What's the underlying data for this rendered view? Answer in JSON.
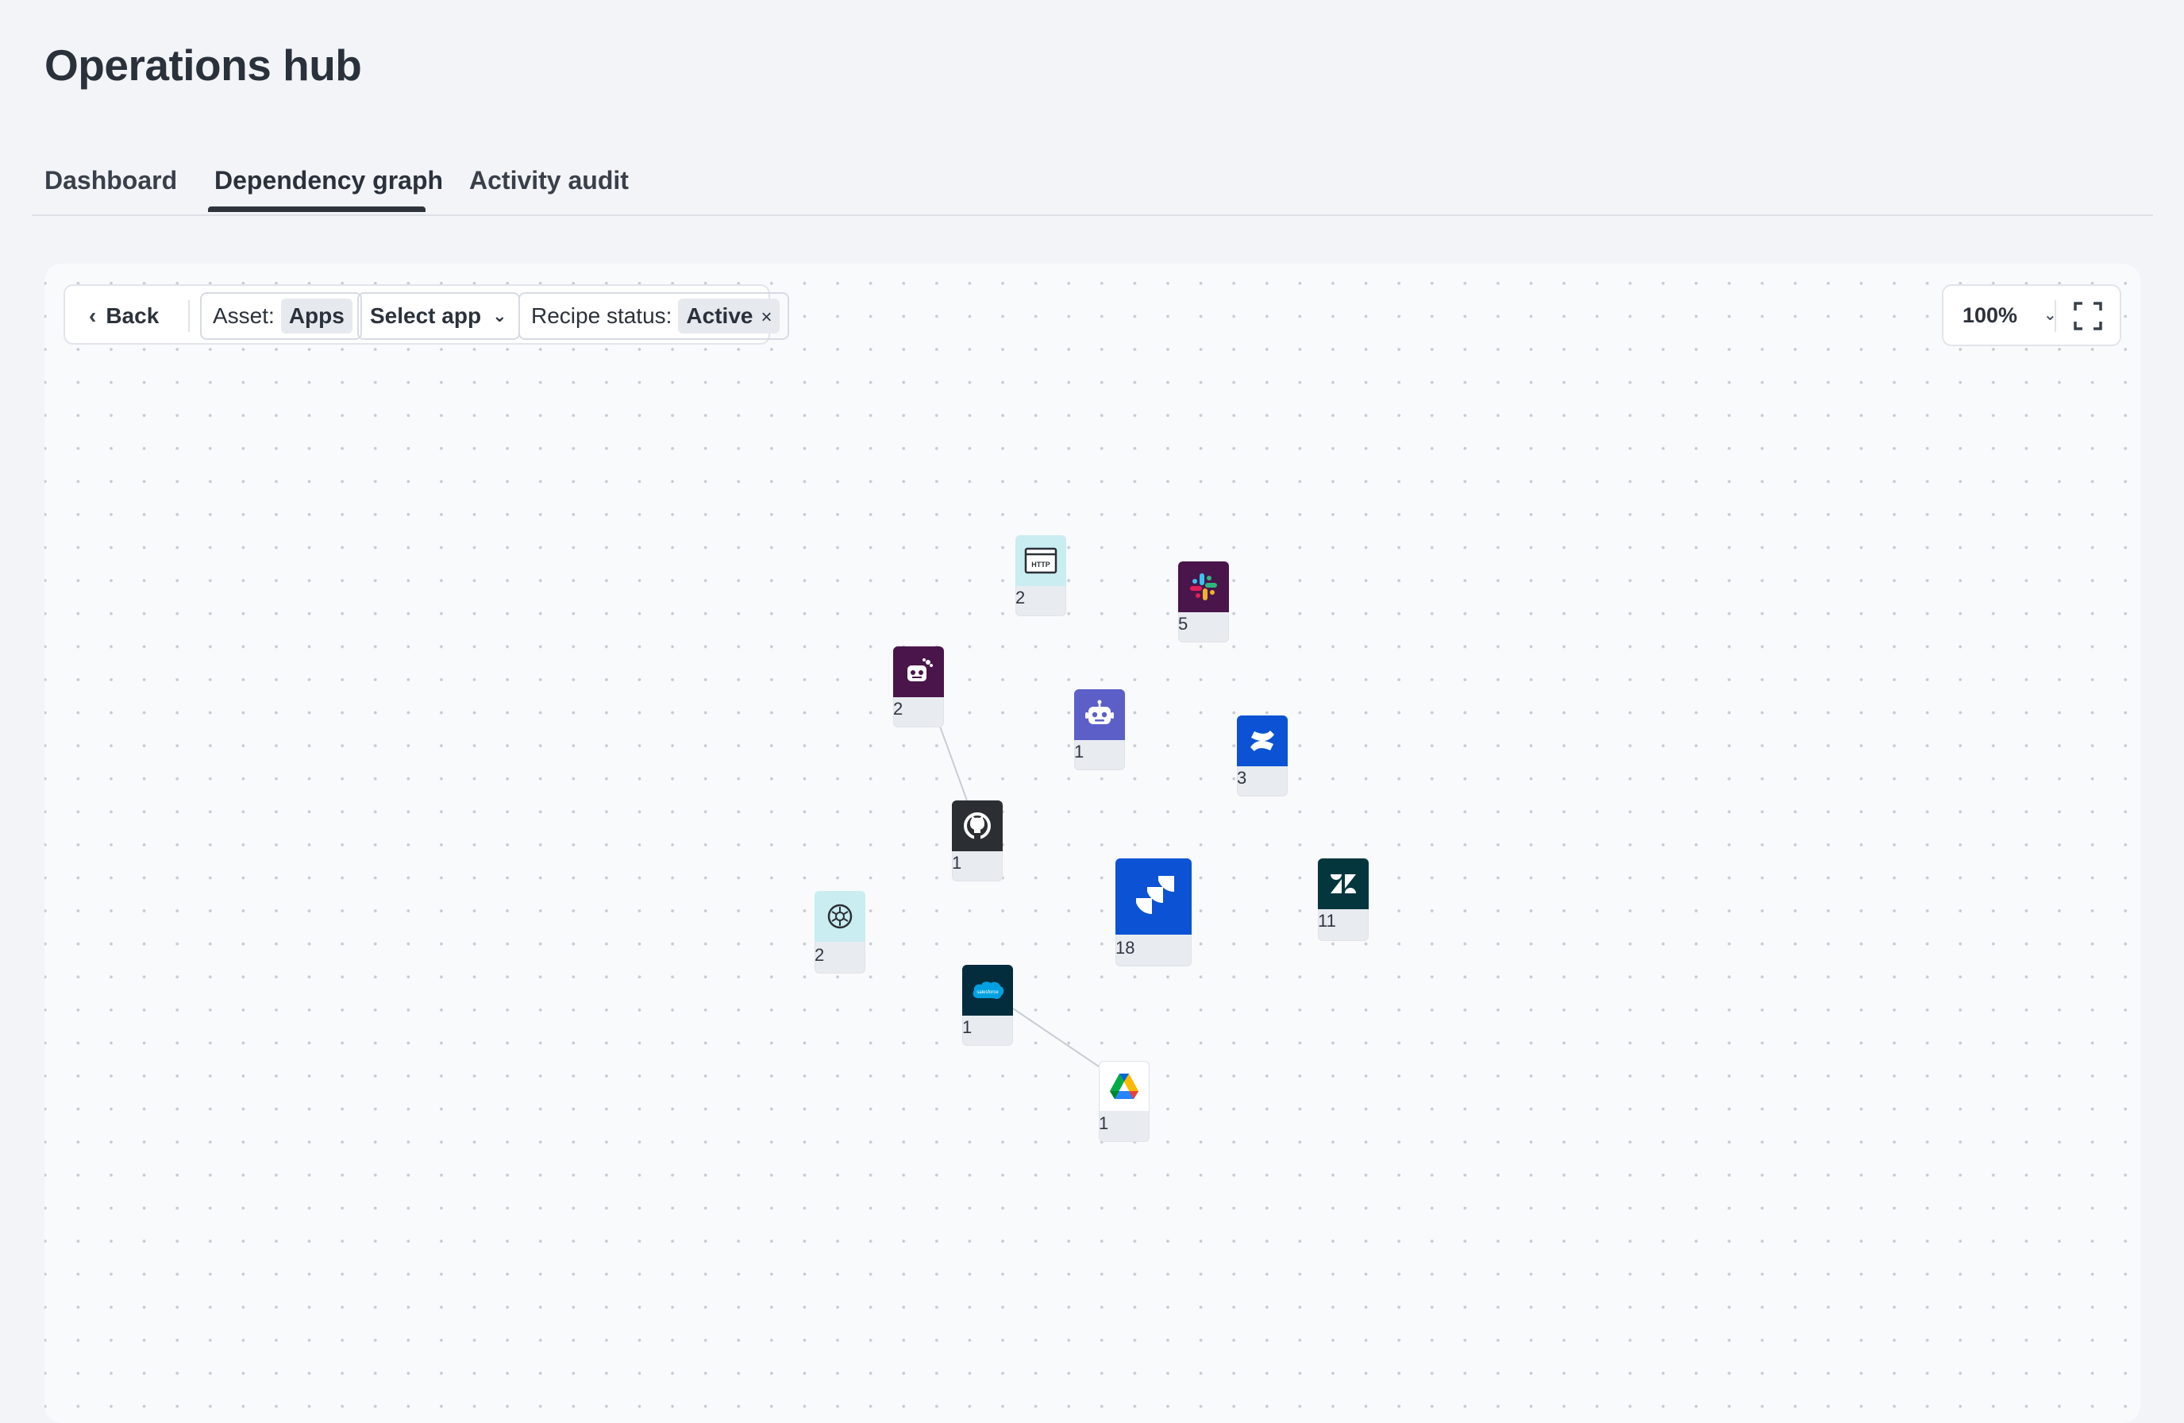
{
  "header": {
    "title": "Operations hub"
  },
  "tabs": [
    {
      "label": "Dashboard",
      "active": false
    },
    {
      "label": "Dependency graph",
      "active": true
    },
    {
      "label": "Activity audit",
      "active": false
    }
  ],
  "toolbar": {
    "back_label": "Back",
    "asset_label": "Asset:",
    "asset_value": "Apps",
    "select_app_label": "Select app",
    "recipe_status_label": "Recipe status:",
    "recipe_status_value": "Active"
  },
  "zoom": {
    "level": "100%"
  },
  "graph": {
    "nodes": [
      {
        "id": "http",
        "app_icon": "http-icon",
        "count": "2"
      },
      {
        "id": "slack",
        "app_icon": "slack-icon",
        "count": "5"
      },
      {
        "id": "slack-bot",
        "app_icon": "slack-bot-icon",
        "count": "2"
      },
      {
        "id": "teams-bot",
        "app_icon": "teams-bot-icon",
        "count": "1"
      },
      {
        "id": "confluence",
        "app_icon": "confluence-icon",
        "count": "3"
      },
      {
        "id": "github",
        "app_icon": "github-icon",
        "count": "1"
      },
      {
        "id": "jira",
        "app_icon": "jira-icon",
        "count": "18"
      },
      {
        "id": "zendesk",
        "app_icon": "zendesk-icon",
        "count": "11"
      },
      {
        "id": "openai",
        "app_icon": "openai-icon",
        "count": "2"
      },
      {
        "id": "salesforce",
        "app_icon": "salesforce-icon",
        "count": "1"
      },
      {
        "id": "google-drive",
        "app_icon": "google-drive-icon",
        "count": "1"
      }
    ],
    "edges": [
      {
        "from": "slack-bot",
        "to": "github"
      },
      {
        "from": "salesforce",
        "to": "google-drive"
      }
    ]
  },
  "colors": {
    "slack": "#4a154b",
    "teams": "#5b5fc7",
    "confluence": "#0b53d4",
    "jira": "#0b53d4",
    "github": "#24292f",
    "zendesk": "#03363d",
    "salesforce": "#032d3d",
    "teal_bg": "#c9edf0"
  }
}
